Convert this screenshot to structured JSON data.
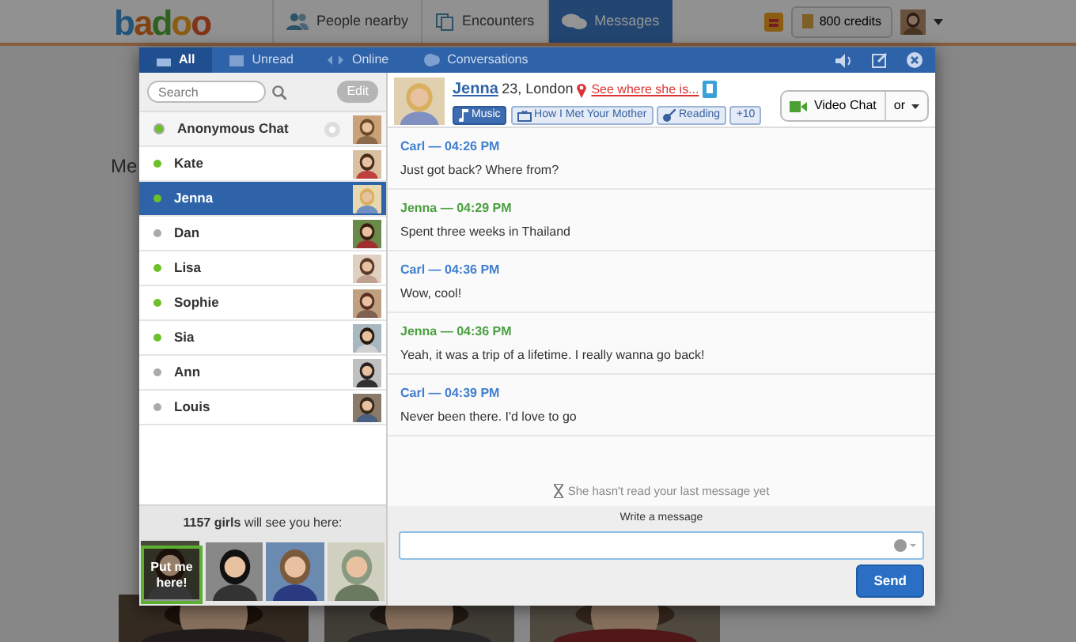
{
  "header": {
    "logo": "badoo",
    "tabs": [
      {
        "label": "People nearby",
        "selected": false
      },
      {
        "label": "Encounters",
        "selected": false
      },
      {
        "label": "Messages",
        "selected": true
      }
    ],
    "credits": "800 credits"
  },
  "page": {
    "heading": "Me"
  },
  "messenger": {
    "tabs": [
      {
        "label": "All",
        "selected": true
      },
      {
        "label": "Unread",
        "selected": false
      },
      {
        "label": "Online",
        "selected": false
      },
      {
        "label": "Conversations",
        "selected": false
      }
    ],
    "search": {
      "placeholder": "Search"
    },
    "edit_button": "Edit",
    "contacts": [
      {
        "kind": "anonymous",
        "name": "Anonymous Chat",
        "online": true,
        "selected": false
      },
      {
        "kind": "person",
        "name": "Kate",
        "online": true,
        "selected": false
      },
      {
        "kind": "person",
        "name": "Jenna",
        "online": true,
        "selected": true
      },
      {
        "kind": "person",
        "name": "Dan",
        "online": false,
        "selected": false
      },
      {
        "kind": "person",
        "name": "Lisa",
        "online": true,
        "selected": false
      },
      {
        "kind": "person",
        "name": "Sophie",
        "online": true,
        "selected": false
      },
      {
        "kind": "person",
        "name": "Sia",
        "online": true,
        "selected": false
      },
      {
        "kind": "person",
        "name": "Ann",
        "online": false,
        "selected": false
      },
      {
        "kind": "person",
        "name": "Louis",
        "online": false,
        "selected": false
      }
    ],
    "promo": {
      "text": "**1157 girls** will see you here:",
      "tile": "Put me here!"
    },
    "profile": {
      "name": "Jenna",
      "details": "23, London",
      "location_link": "See where she is...",
      "interests": [
        {
          "kind": "music",
          "label": "Music",
          "highlighted": true
        },
        {
          "kind": "tv",
          "label": "How I Met Your Mother",
          "highlighted": false
        },
        {
          "kind": "guitar",
          "label": "Reading",
          "highlighted": false
        }
      ],
      "more": "+10",
      "video_chat": "Video Chat",
      "or": "or"
    },
    "messages": [
      {
        "kind": "mine",
        "author": "Carl — 04:26 PM",
        "text": "Just got back? Where from?"
      },
      {
        "kind": "theirs",
        "author": "Jenna — 04:29 PM",
        "text": "Spent three weeks in Thailand"
      },
      {
        "kind": "mine",
        "author": "Carl — 04:36 PM",
        "text": "Wow, cool!"
      },
      {
        "kind": "theirs",
        "author": "Jenna — 04:36 PM",
        "text": "Yeah, it was a trip of a lifetime. I really wanna go back!"
      },
      {
        "kind": "mine",
        "author": "Carl — 04:39 PM",
        "text": "Never been there. I'd love to go"
      }
    ],
    "read_status": "She hasn't read your last message yet",
    "compose_label": "Write a message",
    "send": "Send"
  }
}
